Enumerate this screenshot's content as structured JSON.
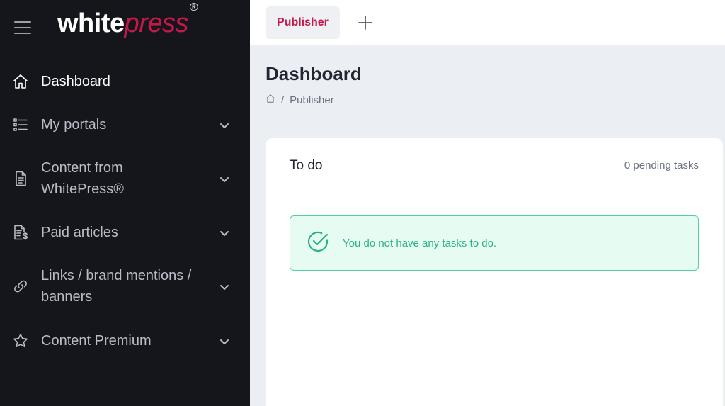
{
  "brand": {
    "logo_white": "white",
    "logo_accent": "press",
    "logo_mark": "®"
  },
  "sidebar": {
    "items": [
      {
        "label": "Dashboard",
        "icon": "home-icon",
        "active": true
      },
      {
        "label": "My portals",
        "icon": "list-icon"
      },
      {
        "label_line1": "Content from",
        "label_line2": "WhitePress®",
        "icon": "document-icon"
      },
      {
        "label": "Paid articles",
        "icon": "invoice-dollar-icon"
      },
      {
        "label_line1": "Links / brand mentions /",
        "label_line2": "banners",
        "icon": "link-icon"
      },
      {
        "label": "Content Premium",
        "icon": "star-icon"
      }
    ]
  },
  "topbar": {
    "tab_label": "Publisher"
  },
  "page": {
    "title": "Dashboard",
    "breadcrumb_sep": "/",
    "breadcrumb_current": "Publisher"
  },
  "todo": {
    "title": "To do",
    "meta": "0 pending tasks",
    "alert_text": "You do not have any tasks to do."
  },
  "colors": {
    "sidebar_bg": "#14161b",
    "brand_accent": "#c4174a",
    "success_green": "#2bb37f"
  }
}
